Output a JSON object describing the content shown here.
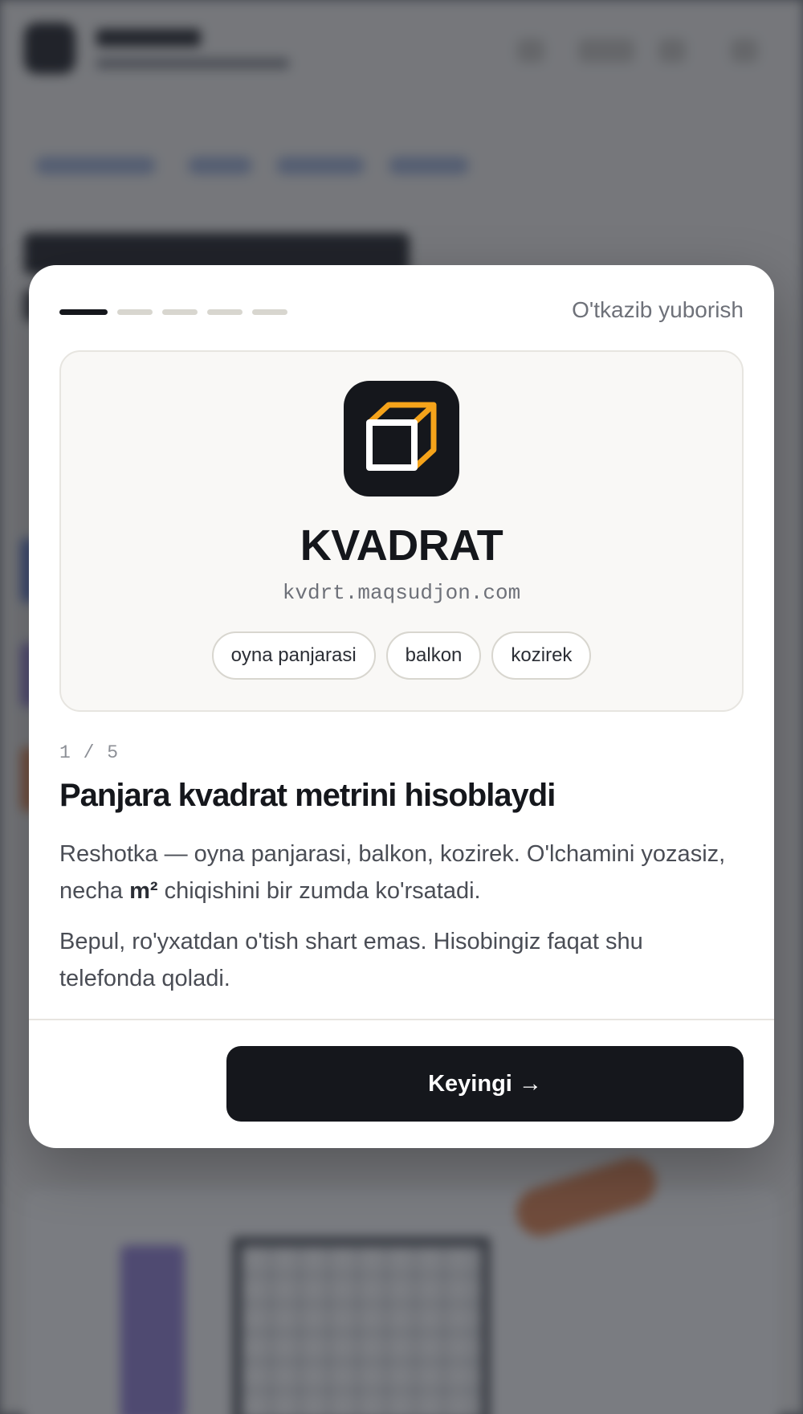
{
  "onboarding": {
    "skip_label": "O'tkazib yuboris​h",
    "progress_current": 1,
    "progress_total": 5,
    "app_name": "KVADRAT",
    "app_url": "kvdrt.maqsudjon.com",
    "tags": [
      "oyna panjarasi",
      "balkon",
      "kozirek"
    ],
    "counter": "1 / 5",
    "title": "Panjara kvadrat metrini hisoblaydi",
    "para1_before": "Reshotka — oyna panjarasi, balkon, kozirek. O'lchamini yozasiz, necha ",
    "para1_bold": "m²",
    "para1_after": " chiqishini bir zumda ko'rsatadi.",
    "para2": "Bepul, ro'yxatdan o'tish shart emas. Hisobingiz faqat shu telefonda qoladi.",
    "next_label": "Keyingi →"
  },
  "colors": {
    "accent_dark": "#15171c",
    "icon_orange": "#f5a31a",
    "progress_inactive": "#d8d6cf"
  }
}
